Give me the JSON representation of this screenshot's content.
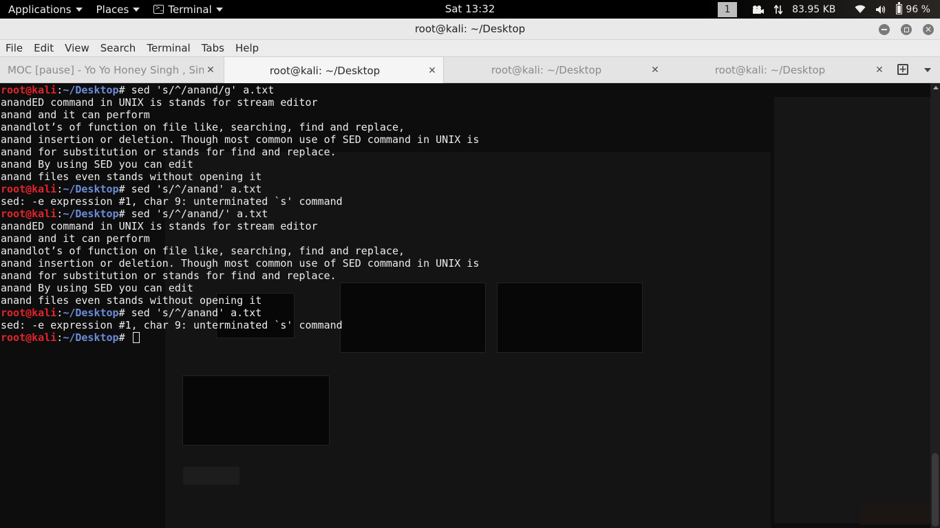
{
  "topbar": {
    "applications": "Applications",
    "places": "Places",
    "terminal": "Terminal",
    "clock": "Sat 13:32",
    "workspace": "1",
    "net_rate": "83.95 KB",
    "battery": "96 %"
  },
  "window": {
    "title": "root@kali: ~/Desktop"
  },
  "menubar": {
    "items": [
      "File",
      "Edit",
      "View",
      "Search",
      "Terminal",
      "Tabs",
      "Help"
    ]
  },
  "tabs": [
    {
      "label": "MOC [pause] - Yo Yo Honey Singh , Sima...",
      "active": false
    },
    {
      "label": "root@kali: ~/Desktop",
      "active": true
    },
    {
      "label": "root@kali: ~/Desktop",
      "active": false
    },
    {
      "label": "root@kali: ~/Desktop",
      "active": false
    }
  ],
  "terminal": {
    "prompt": {
      "user_host": "root@kali",
      "colon": ":",
      "path": "~/Desktop",
      "symbol": "# "
    },
    "lines": [
      {
        "type": "cmd",
        "text": "sed 's/^/anand/g' a.txt"
      },
      {
        "type": "out",
        "text": "anandED command in UNIX is stands for stream editor"
      },
      {
        "type": "out",
        "text": "anand and it can perform"
      },
      {
        "type": "out",
        "text": "anandlot’s of function on file like, searching, find and replace,"
      },
      {
        "type": "out",
        "text": "anand insertion or deletion. Though most common use of SED command in UNIX is"
      },
      {
        "type": "out",
        "text": "anand for substitution or stands for find and replace."
      },
      {
        "type": "out",
        "text": "anand By using SED you can edit"
      },
      {
        "type": "out",
        "text": "anand files even stands without opening it"
      },
      {
        "type": "cmd",
        "text": "sed 's/^/anand' a.txt"
      },
      {
        "type": "out",
        "text": "sed: -e expression #1, char 9: unterminated `s' command"
      },
      {
        "type": "cmd",
        "text": "sed 's/^/anand/' a.txt"
      },
      {
        "type": "out",
        "text": "anandED command in UNIX is stands for stream editor"
      },
      {
        "type": "out",
        "text": "anand and it can perform"
      },
      {
        "type": "out",
        "text": "anandlot’s of function on file like, searching, find and replace,"
      },
      {
        "type": "out",
        "text": "anand insertion or deletion. Though most common use of SED command in UNIX is"
      },
      {
        "type": "out",
        "text": "anand for substitution or stands for find and replace."
      },
      {
        "type": "out",
        "text": "anand By using SED you can edit"
      },
      {
        "type": "out",
        "text": "anand files even stands without opening it"
      },
      {
        "type": "cmd",
        "text": "sed 's/^/anand' a.txt"
      },
      {
        "type": "out",
        "text": "sed: -e expression #1, char 9: unterminated `s' command"
      },
      {
        "type": "cmd",
        "text": ""
      }
    ]
  },
  "colors": {
    "prompt_user": "#e3242b",
    "prompt_path": "#6b8cd8",
    "terminal_bg": "#0d0d0d",
    "terminal_fg": "#ececec"
  },
  "icons": {
    "terminal": "terminal-icon",
    "network": "network-icon",
    "wifi": "wifi-icon",
    "volume": "volume-icon",
    "battery": "battery-icon",
    "new_tab": "new-tab-icon"
  }
}
